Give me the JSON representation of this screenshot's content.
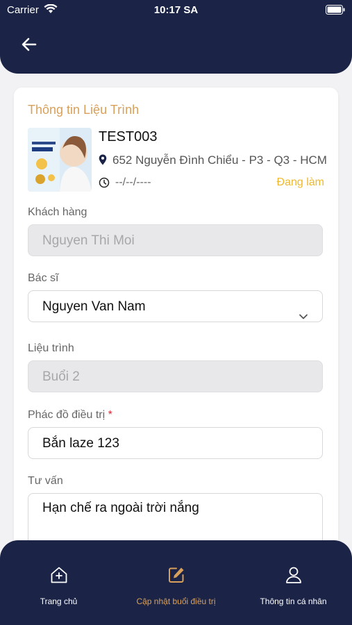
{
  "status_bar": {
    "carrier": "Carrier",
    "time": "10:17 SA"
  },
  "card": {
    "title": "Thông tin Liệu Trình",
    "item": {
      "code": "TEST003",
      "address": "652 Nguyễn Đình Chiểu - P3 - Q3 - HCM",
      "date": "--/--/----",
      "status": "Đang làm",
      "status_color": "#f0b92b"
    }
  },
  "form": {
    "customer": {
      "label": "Khách hàng",
      "value": "Nguyen Thi Moi"
    },
    "doctor": {
      "label": "Bác sĩ",
      "value": "Nguyen Van Nam"
    },
    "treatment": {
      "label": "Liệu trình",
      "value": "Buổi 2"
    },
    "protocol": {
      "label": "Phác đồ điều trị",
      "required": "*",
      "value": "Bắn laze 123"
    },
    "advice": {
      "label": "Tư vấn",
      "value": "Hạn chế ra ngoài trời nắng"
    }
  },
  "nav": {
    "items": [
      {
        "label": "Trang chủ",
        "icon": "home-plus-icon"
      },
      {
        "label": "Cập nhật buổi điều trị",
        "icon": "edit-icon",
        "active": true
      },
      {
        "label": "Thông tin cá nhân",
        "icon": "user-icon"
      }
    ]
  },
  "colors": {
    "primary": "#1b2447",
    "accent": "#d9a05b",
    "status": "#f0b92b"
  }
}
